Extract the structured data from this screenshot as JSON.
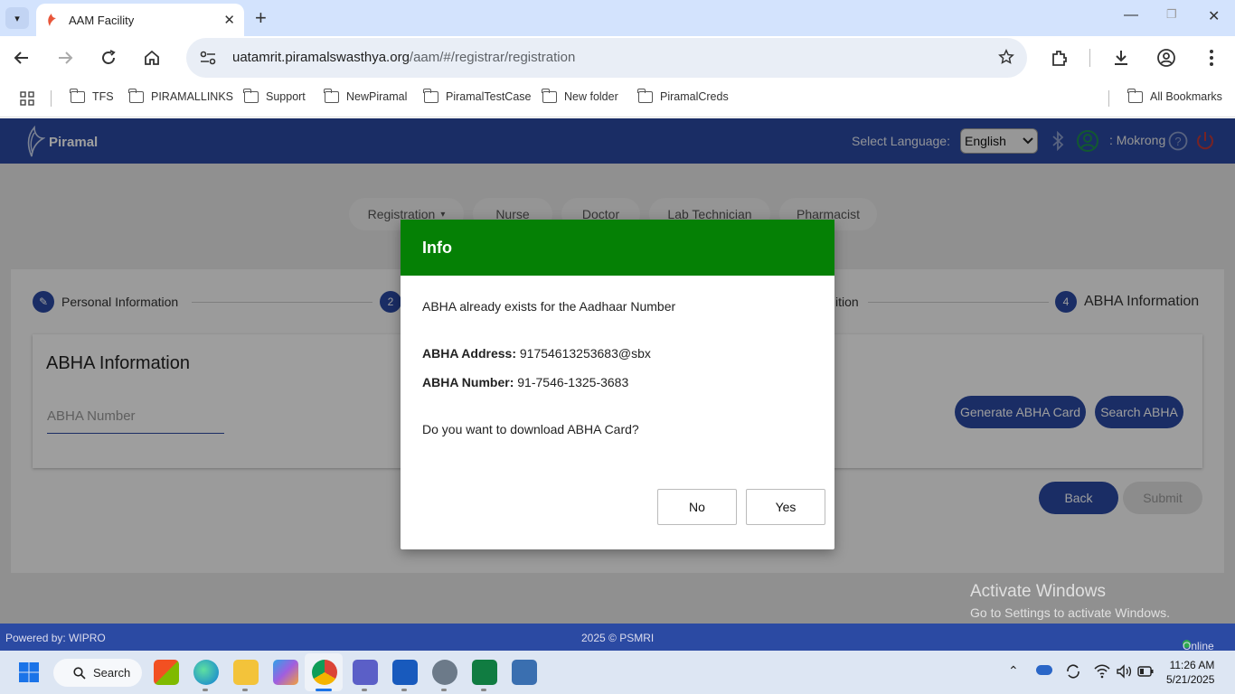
{
  "browser": {
    "tab_title": "AAM Facility",
    "url_host": "uatamrit.piramalswasthya.org",
    "url_path": "/aam/#/registrar/registration",
    "bookmarks": [
      "TFS",
      "PIRAMALLINKS",
      "Support",
      "NewPiramal",
      "PiramalTestCase",
      "New folder",
      "PiramalCreds"
    ],
    "all_bookmarks": "All Bookmarks"
  },
  "app": {
    "brand": "Piramal",
    "language_label": "Select Language:",
    "language_value": "English",
    "user_name": ": Mokrong",
    "roles": [
      "Registration",
      "Nurse",
      "Doctor",
      "Lab Technician",
      "Pharmacist"
    ],
    "steps": {
      "step1": "Personal Information",
      "step2_num": "2",
      "step3_partial": "ition",
      "step4_num": "4",
      "step4": "ABHA Information"
    },
    "card_title": "ABHA Information",
    "abha_number_placeholder": "ABHA Number",
    "generate_btn": "Generate ABHA Card",
    "search_btn": "Search ABHA",
    "back_btn": "Back",
    "submit_btn": "Submit",
    "footer": {
      "powered": "Powered by: WIPRO",
      "copyright": "2025 © PSMRI",
      "status": "Online"
    }
  },
  "dialog": {
    "title": "Info",
    "message": "ABHA already exists for the Aadhaar Number",
    "address_label": "ABHA Address:",
    "address_value": "91754613253683@sbx",
    "number_label": "ABHA Number:",
    "number_value": "91-7546-1325-3683",
    "question": "Do you want to download ABHA Card?",
    "no": "No",
    "yes": "Yes"
  },
  "watermark": {
    "line1": "Activate Windows",
    "line2": "Go to Settings to activate Windows."
  },
  "taskbar": {
    "search": "Search",
    "time": "11:26 AM",
    "date": "5/21/2025"
  },
  "colors": {
    "brand_blue": "#2b4aa3",
    "dialog_green": "#058005"
  }
}
